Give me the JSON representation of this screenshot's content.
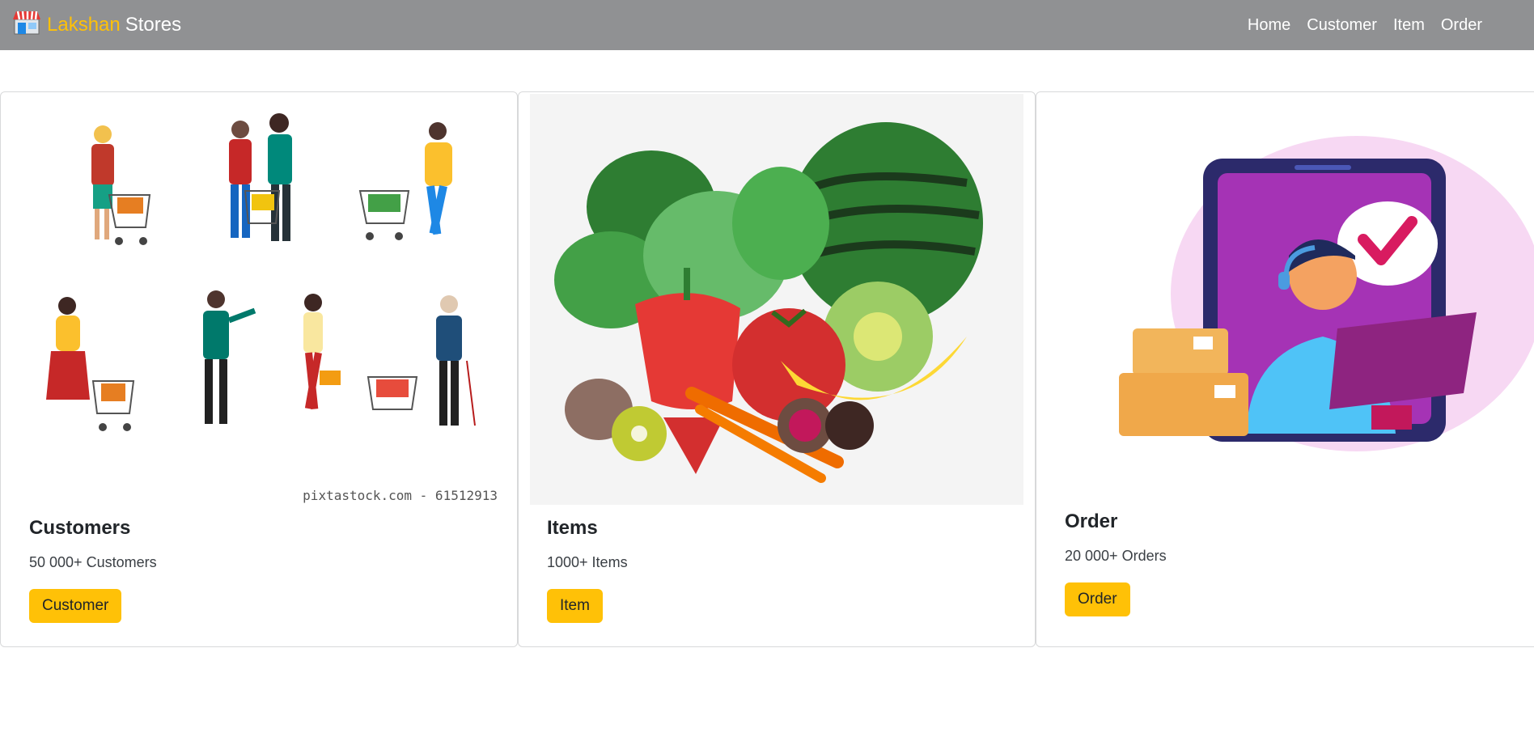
{
  "navbar": {
    "brand_accent": "Lakshan",
    "brand_rest": "Stores",
    "links": [
      "Home",
      "Customer",
      "Item",
      "Order"
    ]
  },
  "cards": [
    {
      "title": "Customers",
      "text": "50 000+ Customers",
      "button": "Customer",
      "image_caption": "pixtastock.com - 61512913"
    },
    {
      "title": "Items",
      "text": "1000+ Items",
      "button": "Item"
    },
    {
      "title": "Order",
      "text": "20 000+ Orders",
      "button": "Order"
    }
  ],
  "colors": {
    "navbar_bg": "#909193",
    "brand_accent": "#ffc107",
    "button_bg": "#ffc107"
  }
}
